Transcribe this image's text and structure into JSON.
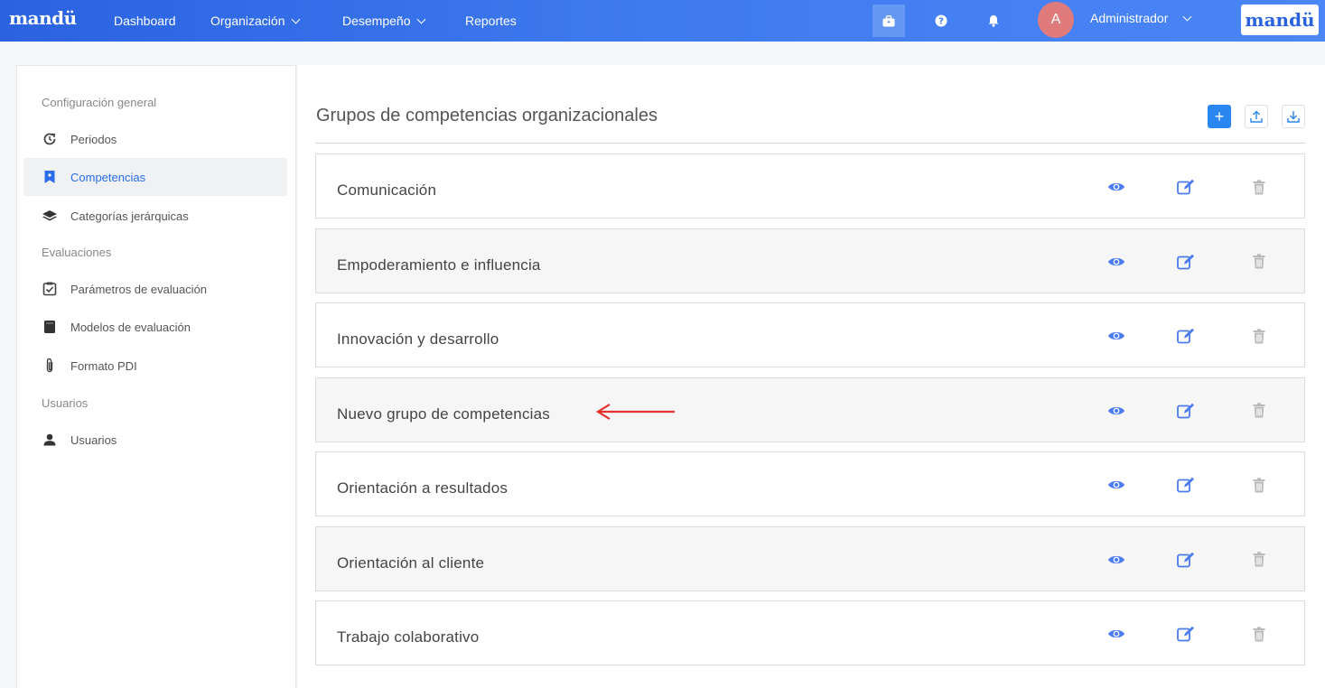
{
  "topbar": {
    "logo": "mandü",
    "nav": [
      "Dashboard",
      "Organización",
      "Desempeño",
      "Reportes"
    ],
    "user_initial": "A",
    "user_name": "Administrador",
    "brand_logo": "mandü",
    "icons": [
      "briefcase-icon",
      "help-icon",
      "bell-icon"
    ],
    "colors": {
      "bar_start": "#2a62e0",
      "bar_end": "#4a86f5",
      "avatar": "#e07b7b"
    }
  },
  "sidebar": {
    "sections": [
      {
        "label": "Configuración general"
      },
      {
        "label": "Evaluaciones"
      },
      {
        "label": "Usuarios"
      }
    ],
    "items": [
      {
        "label": "Periodos",
        "icon": "history-icon"
      },
      {
        "label": "Competencias",
        "icon": "bookmark-icon",
        "active": true
      },
      {
        "label": "Categorías jerárquicas",
        "icon": "layers-icon"
      },
      {
        "label": "Parámetros de evaluación",
        "icon": "checkbox-icon"
      },
      {
        "label": "Modelos de evaluación",
        "icon": "book-icon"
      },
      {
        "label": "Formato PDI",
        "icon": "paperclip-icon"
      },
      {
        "label": "Usuarios",
        "icon": "user-icon"
      }
    ],
    "active_color": "#2a6de8"
  },
  "main": {
    "title": "Grupos de competencias organizacionales",
    "add_label": "+",
    "groups": [
      {
        "name": "Comunicación"
      },
      {
        "name": "Empoderamiento e influencia"
      },
      {
        "name": "Innovación y desarrollo"
      },
      {
        "name": "Nuevo grupo de competencias",
        "highlighted": true
      },
      {
        "name": "Orientación a resultados"
      },
      {
        "name": "Orientación al cliente"
      },
      {
        "name": "Trabajo colaborativo"
      }
    ],
    "row_icons": [
      "eye-icon",
      "edit-icon",
      "trash-icon"
    ],
    "colors": {
      "action": "#4a7cf0",
      "delete": "#b8b8b8",
      "add_button": "#2a86f0",
      "arrow": "#e8302e"
    }
  }
}
